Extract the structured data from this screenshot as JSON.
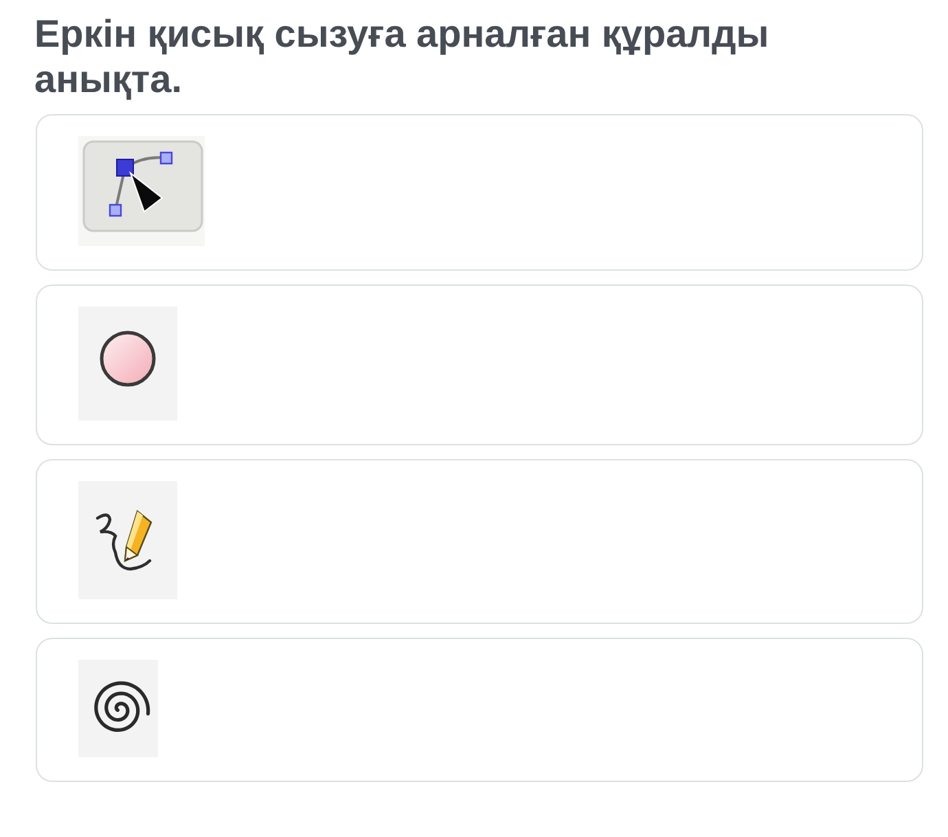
{
  "question": "Еркін қисық сызуға арналған құралды анықта.",
  "options": [
    {
      "kind": "bezier"
    },
    {
      "kind": "circle"
    },
    {
      "kind": "pencil"
    },
    {
      "kind": "spiral"
    }
  ]
}
